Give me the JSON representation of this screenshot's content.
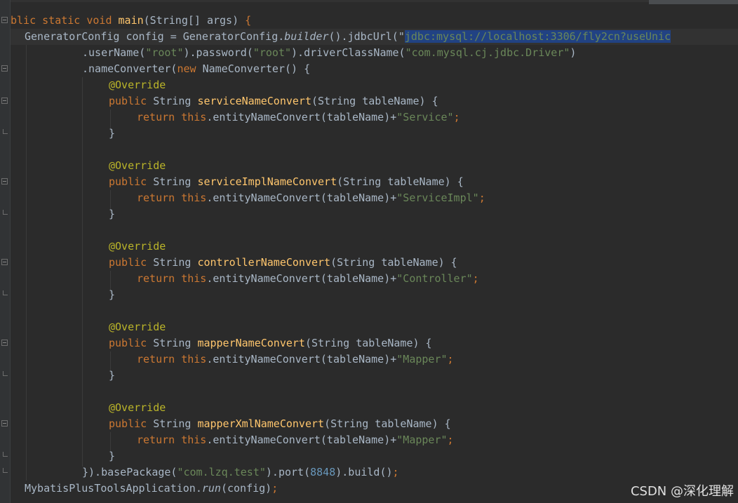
{
  "editor": {
    "lines": [
      {
        "segments": [
          {
            "t": "blic static void ",
            "c": "kw"
          },
          {
            "t": "main",
            "c": "fn"
          },
          {
            "t": "(String[] args) ",
            "c": ""
          },
          {
            "t": "{",
            "c": "kw"
          }
        ]
      },
      {
        "segments": [
          {
            "t": "GeneratorConfig config = GeneratorConfig.",
            "c": ""
          },
          {
            "t": "builder",
            "c": "it"
          },
          {
            "t": "().jdbcUrl(\"",
            "c": ""
          },
          {
            "t": "jdbc:mysql://localhost:3306/fly2cn?useUnic",
            "c": "str sel"
          }
        ]
      },
      {
        "segments": [
          {
            "t": ".userName(",
            "c": ""
          },
          {
            "t": "\"root\"",
            "c": "str"
          },
          {
            "t": ").password(",
            "c": ""
          },
          {
            "t": "\"root\"",
            "c": "str"
          },
          {
            "t": ").driverClassName(",
            "c": ""
          },
          {
            "t": "\"com.mysql.cj.jdbc.Driver\"",
            "c": "str"
          },
          {
            "t": ")",
            "c": ""
          }
        ]
      },
      {
        "segments": [
          {
            "t": ".nameConverter(",
            "c": ""
          },
          {
            "t": "new ",
            "c": "kw"
          },
          {
            "t": "NameConverter() ",
            "c": ""
          },
          {
            "t": "{",
            "c": ""
          }
        ]
      },
      {
        "segments": [
          {
            "t": "@Override",
            "c": "ann"
          }
        ]
      },
      {
        "segments": [
          {
            "t": "public ",
            "c": "kw"
          },
          {
            "t": "String ",
            "c": ""
          },
          {
            "t": "serviceNameConvert",
            "c": "fn"
          },
          {
            "t": "(String tableName) {",
            "c": ""
          }
        ]
      },
      {
        "segments": [
          {
            "t": "return this",
            "c": "kw"
          },
          {
            "t": ".entityNameConvert(tableName)+",
            "c": ""
          },
          {
            "t": "\"Service\"",
            "c": "str"
          },
          {
            "t": ";",
            "c": "kw"
          }
        ]
      },
      {
        "segments": [
          {
            "t": "}",
            "c": ""
          }
        ]
      },
      {
        "segments": []
      },
      {
        "segments": [
          {
            "t": "@Override",
            "c": "ann"
          }
        ]
      },
      {
        "segments": [
          {
            "t": "public ",
            "c": "kw"
          },
          {
            "t": "String ",
            "c": ""
          },
          {
            "t": "serviceImplNameConvert",
            "c": "fn"
          },
          {
            "t": "(String tableName) {",
            "c": ""
          }
        ]
      },
      {
        "segments": [
          {
            "t": "return this",
            "c": "kw"
          },
          {
            "t": ".entityNameConvert(tableName)+",
            "c": ""
          },
          {
            "t": "\"ServiceImpl\"",
            "c": "str"
          },
          {
            "t": ";",
            "c": "kw"
          }
        ]
      },
      {
        "segments": [
          {
            "t": "}",
            "c": ""
          }
        ]
      },
      {
        "segments": []
      },
      {
        "segments": [
          {
            "t": "@Override",
            "c": "ann"
          }
        ]
      },
      {
        "segments": [
          {
            "t": "public ",
            "c": "kw"
          },
          {
            "t": "String ",
            "c": ""
          },
          {
            "t": "controllerNameConvert",
            "c": "fn"
          },
          {
            "t": "(String tableName) {",
            "c": ""
          }
        ]
      },
      {
        "segments": [
          {
            "t": "return this",
            "c": "kw"
          },
          {
            "t": ".entityNameConvert(tableName)+",
            "c": ""
          },
          {
            "t": "\"Controller\"",
            "c": "str"
          },
          {
            "t": ";",
            "c": "kw"
          }
        ]
      },
      {
        "segments": [
          {
            "t": "}",
            "c": ""
          }
        ]
      },
      {
        "segments": []
      },
      {
        "segments": [
          {
            "t": "@Override",
            "c": "ann"
          }
        ]
      },
      {
        "segments": [
          {
            "t": "public ",
            "c": "kw"
          },
          {
            "t": "String ",
            "c": ""
          },
          {
            "t": "mapperNameConvert",
            "c": "fn"
          },
          {
            "t": "(String tableName) {",
            "c": ""
          }
        ]
      },
      {
        "segments": [
          {
            "t": "return this",
            "c": "kw"
          },
          {
            "t": ".entityNameConvert(tableName)+",
            "c": ""
          },
          {
            "t": "\"Mapper\"",
            "c": "str"
          },
          {
            "t": ";",
            "c": "kw"
          }
        ]
      },
      {
        "segments": [
          {
            "t": "}",
            "c": ""
          }
        ]
      },
      {
        "segments": []
      },
      {
        "segments": [
          {
            "t": "@Override",
            "c": "ann"
          }
        ]
      },
      {
        "segments": [
          {
            "t": "public ",
            "c": "kw"
          },
          {
            "t": "String ",
            "c": ""
          },
          {
            "t": "mapperXmlNameConvert",
            "c": "fn"
          },
          {
            "t": "(String tableName) {",
            "c": ""
          }
        ]
      },
      {
        "segments": [
          {
            "t": "return this",
            "c": "kw"
          },
          {
            "t": ".entityNameConvert(tableName)+",
            "c": ""
          },
          {
            "t": "\"Mapper\"",
            "c": "str"
          },
          {
            "t": ";",
            "c": "kw"
          }
        ]
      },
      {
        "segments": [
          {
            "t": "}",
            "c": ""
          }
        ]
      },
      {
        "segments": [
          {
            "t": "}).basePackage(",
            "c": ""
          },
          {
            "t": "\"com.lzq.test\"",
            "c": "str"
          },
          {
            "t": ").port(",
            "c": ""
          },
          {
            "t": "8848",
            "c": "num"
          },
          {
            "t": ").build()",
            "c": ""
          },
          {
            "t": ";",
            "c": "kw"
          }
        ]
      },
      {
        "segments": [
          {
            "t": "MybatisPlusToolsApplication.",
            "c": ""
          },
          {
            "t": "run",
            "c": "it"
          },
          {
            "t": "(config)",
            "c": ""
          },
          {
            "t": ";",
            "c": "kw"
          }
        ]
      }
    ]
  },
  "watermark": "CSDN @深化理解",
  "colors": {
    "background": "#2b2b2b",
    "keyword": "#cc7832",
    "method": "#ffc66d",
    "string": "#6a8759",
    "number": "#6897bb",
    "annotation": "#bbb529",
    "text": "#a9b7c6",
    "selection": "#214283"
  }
}
